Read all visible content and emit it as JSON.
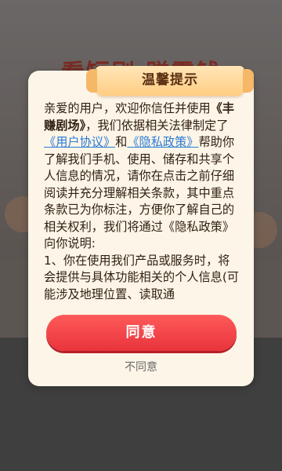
{
  "background": {
    "headline": "看短剧 赚零钱"
  },
  "dialog": {
    "title": "温馨提示",
    "paragraph": {
      "p1": "亲爱的用户，欢迎你信任并使用",
      "app_name": "《丰赚剧场》",
      "p2": "，我们依据相关法律制定了",
      "link_user_agreement": "《用户协议》",
      "p3": "和",
      "link_privacy": "《隐私政策》",
      "p4": "帮助你了解我们手机、使用、储存和共享个人信息的情况，请你在点击之前仔细阅读并充分理解相关条款，其中重点条款已为你标注，方便你了解自己的相关权利，我们将通过《隐私政策》向你说明:",
      "p5": "1、你在使用我们产品或服务时，将会提供与具体功能相关的个人信息(可 能涉及地理位置、读取通"
    },
    "agree_label": "同意",
    "disagree_label": "不同意"
  },
  "colors": {
    "accent_red": "#e8343c",
    "link_blue": "#2a7bd8",
    "dialog_bg": "#fdf5e7",
    "title_tab": "#ffcd82"
  }
}
